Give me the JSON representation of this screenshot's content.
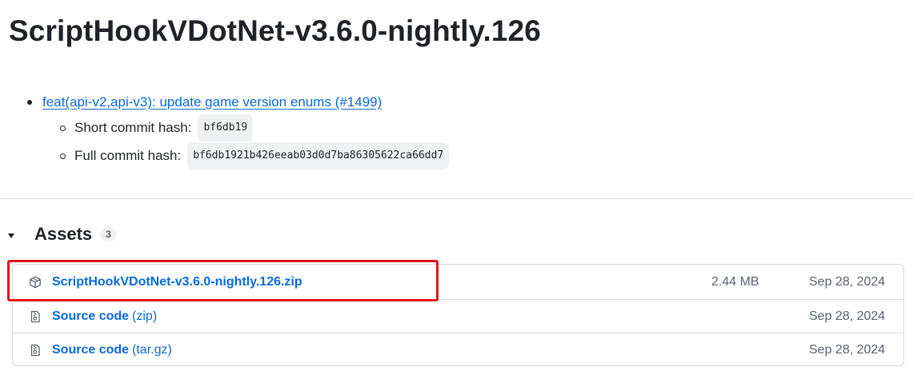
{
  "release": {
    "title": "ScriptHookVDotNet-v3.6.0-nightly.126"
  },
  "notes": {
    "commit_message": "feat(api-v2,api-v3): update game version enums (#1499)",
    "short_hash_label": "Short commit hash:",
    "short_hash": "bf6db19",
    "full_hash_label": "Full commit hash:",
    "full_hash": "bf6db1921b426eeab03d0d7ba86305622ca66dd7"
  },
  "assets": {
    "title": "Assets",
    "count": "3",
    "items": [
      {
        "icon": "package-icon",
        "name": "ScriptHookVDotNet-v3.6.0-nightly.126.zip",
        "suffix": "",
        "size": "2.44 MB",
        "date": "Sep 28, 2024"
      },
      {
        "icon": "file-zip-icon",
        "name": "Source code",
        "suffix": "(zip)",
        "size": "",
        "date": "Sep 28, 2024"
      },
      {
        "icon": "file-zip-icon",
        "name": "Source code",
        "suffix": "(tar.gz)",
        "size": "",
        "date": "Sep 28, 2024"
      }
    ]
  },
  "colors": {
    "link": "#0969da",
    "text": "#1f2328",
    "muted": "#59636e",
    "highlight": "#e1141c"
  }
}
